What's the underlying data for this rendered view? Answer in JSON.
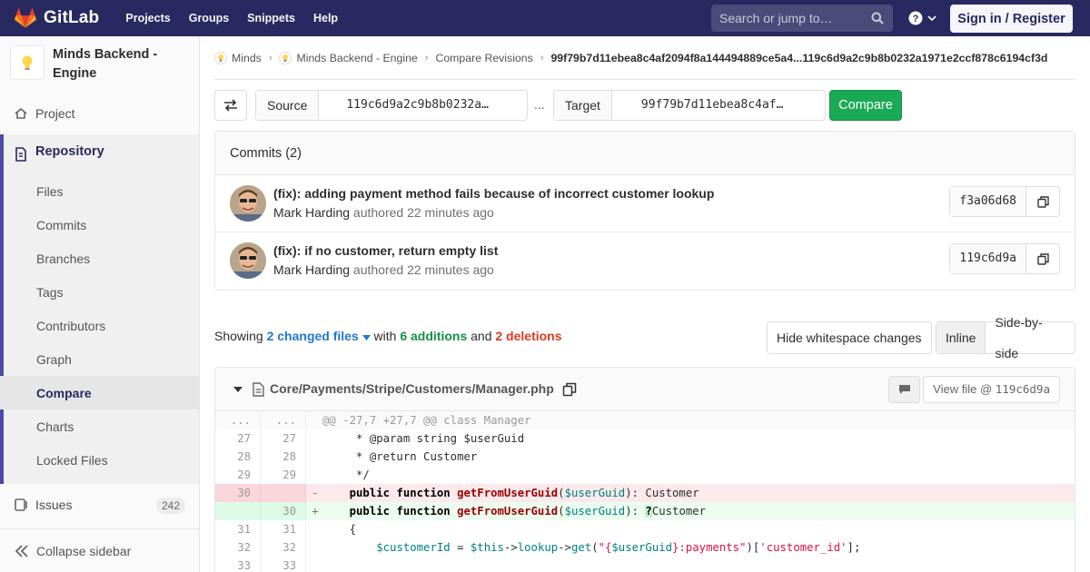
{
  "navbar": {
    "brand": "GitLab",
    "links": [
      "Projects",
      "Groups",
      "Snippets",
      "Help"
    ],
    "search_placeholder": "Search or jump to…",
    "signin_label": "Sign in / Register"
  },
  "sidebar": {
    "project_title": "Minds Backend - Engine",
    "project_label": "Project",
    "repository_label": "Repository",
    "repo_items": [
      "Files",
      "Commits",
      "Branches",
      "Tags",
      "Contributors",
      "Graph",
      "Compare",
      "Charts",
      "Locked Files"
    ],
    "active_item": "Compare",
    "issues_label": "Issues",
    "issues_count": "242",
    "collapse_label": "Collapse sidebar"
  },
  "breadcrumbs": {
    "items": [
      "Minds",
      "Minds Backend - Engine",
      "Compare Revisions"
    ],
    "current": "99f79b7d11ebea8c4af2094f8a144494889ce5a4...119c6d9a2c9b8b0232a1971e2ccf878c6194cf3d"
  },
  "compare": {
    "source_label": "Source",
    "source_value": "119c6d9a2c9b8b0232a…",
    "dots": "...",
    "target_label": "Target",
    "target_value": "99f79b7d11ebea8c4af…",
    "compare_label": "Compare"
  },
  "commits": {
    "header": "Commits (2)",
    "items": [
      {
        "title": "(fix): adding payment method fails because of incorrect customer lookup",
        "author": "Mark Harding",
        "meta": "authored 22 minutes ago",
        "sha": "f3a06d68"
      },
      {
        "title": "(fix): if no customer, return empty list",
        "author": "Mark Harding",
        "meta": "authored 22 minutes ago",
        "sha": "119c6d9a"
      }
    ]
  },
  "stats": {
    "showing": "Showing",
    "changed_files": "2 changed files",
    "with": "with",
    "additions": "6 additions",
    "and": "and",
    "deletions": "2 deletions"
  },
  "view_options": {
    "whitespace": "Hide whitespace changes",
    "inline": "Inline",
    "side_by_side": "Side-by-side"
  },
  "file": {
    "path": "Core/Payments/Stripe/Customers/Manager.php",
    "view_file_label": "View file @",
    "view_file_sha": "119c6d9a"
  },
  "diff_lines": [
    {
      "type": "match",
      "old": "...",
      "new": "...",
      "sign": "",
      "code": "@@ -27,7 +27,7 @@ class Manager"
    },
    {
      "type": "ctx",
      "old": "27",
      "new": "27",
      "sign": "",
      "code": "     * @param string $userGuid"
    },
    {
      "type": "ctx",
      "old": "28",
      "new": "28",
      "sign": "",
      "code": "     * @return Customer"
    },
    {
      "type": "ctx",
      "old": "29",
      "new": "29",
      "sign": "",
      "code": "     */"
    },
    {
      "type": "del",
      "old": "30",
      "new": "",
      "sign": "-",
      "code": "public function getFromUserGuid($userGuid): Customer"
    },
    {
      "type": "add",
      "old": "",
      "new": "30",
      "sign": "+",
      "code": "public function getFromUserGuid($userGuid): ?Customer"
    },
    {
      "type": "ctx",
      "old": "31",
      "new": "31",
      "sign": "",
      "code": "    {"
    },
    {
      "type": "ctx",
      "old": "32",
      "new": "32",
      "sign": "",
      "code": "$customerId = $this->lookup->get(\"{$userGuid}:payments\")['customer_id'];"
    },
    {
      "type": "ctx",
      "old": "33",
      "new": "33",
      "sign": "",
      "code": ""
    }
  ]
}
